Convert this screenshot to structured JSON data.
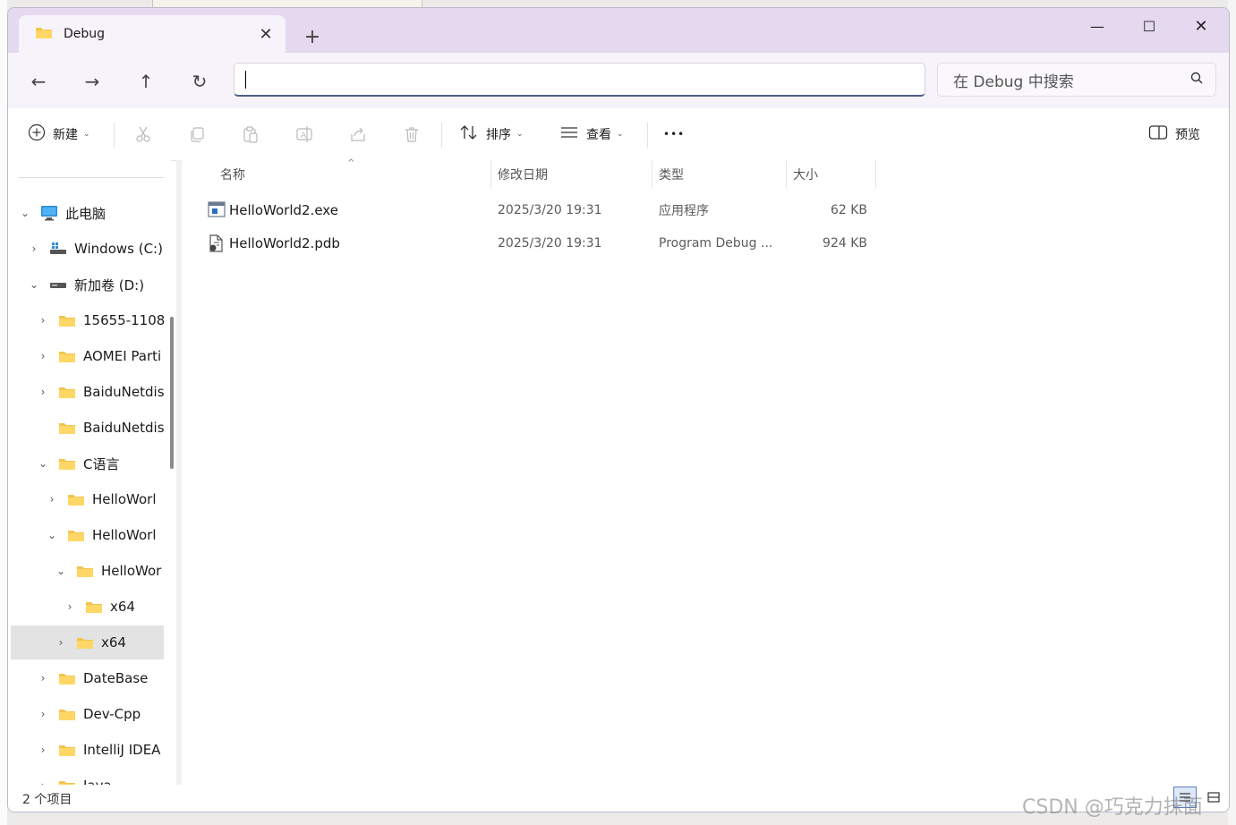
{
  "window": {
    "tab_title": "Debug",
    "new_tab_glyph": "+",
    "close_tab_glyph": "✕",
    "minimize_glyph": "—",
    "maximize_glyph": "☐",
    "close_glyph": "✕"
  },
  "nav": {
    "back_glyph": "←",
    "forward_glyph": "→",
    "up_glyph": "↑",
    "refresh_glyph": "↻",
    "address_value": "",
    "search_placeholder": "在 Debug 中搜索"
  },
  "toolbar": {
    "new_label": "新建",
    "sort_label": "排序",
    "view_label": "查看",
    "more_glyph": "•••",
    "preview_label": "预览",
    "icons": [
      "cut-icon",
      "copy-icon",
      "paste-icon",
      "rename-icon",
      "share-icon",
      "delete-icon"
    ]
  },
  "sidebar": {
    "items": [
      {
        "label": "此电脑",
        "chevron": "⌄",
        "icon": "this-pc-icon"
      },
      {
        "label": "Windows (C:)",
        "chevron": "›",
        "icon": "windows-drive-icon"
      },
      {
        "label": "新加卷 (D:)",
        "chevron": "⌄",
        "icon": "drive-icon"
      },
      {
        "label": "15655-1108",
        "chevron": "›",
        "icon": "folder-icon"
      },
      {
        "label": "AOMEI Parti",
        "chevron": "›",
        "icon": "folder-icon"
      },
      {
        "label": "BaiduNetdis",
        "chevron": "›",
        "icon": "folder-icon"
      },
      {
        "label": "BaiduNetdis",
        "chevron": "",
        "icon": "folder-icon"
      },
      {
        "label": "C语言",
        "chevron": "⌄",
        "icon": "folder-icon"
      },
      {
        "label": "HelloWorl",
        "chevron": "›",
        "icon": "folder-icon"
      },
      {
        "label": "HelloWorl",
        "chevron": "⌄",
        "icon": "folder-icon"
      },
      {
        "label": "HelloWor",
        "chevron": "⌄",
        "icon": "folder-icon"
      },
      {
        "label": "x64",
        "chevron": "›",
        "icon": "folder-icon"
      },
      {
        "label": "x64",
        "chevron": "›",
        "icon": "folder-icon"
      },
      {
        "label": "DateBase",
        "chevron": "›",
        "icon": "folder-icon"
      },
      {
        "label": "Dev-Cpp",
        "chevron": "›",
        "icon": "folder-icon"
      },
      {
        "label": "IntelliJ IDEA",
        "chevron": "›",
        "icon": "folder-icon"
      },
      {
        "label": "Java",
        "chevron": "›",
        "icon": "folder-icon"
      }
    ],
    "selected_index": 12
  },
  "columns": {
    "name": "名称",
    "date": "修改日期",
    "type": "类型",
    "size": "大小",
    "sort_glyph": "^"
  },
  "files": [
    {
      "name": "HelloWorld2.exe",
      "date": "2025/3/20 19:31",
      "type": "应用程序",
      "size": "62 KB",
      "icon": "exe-icon"
    },
    {
      "name": "HelloWorld2.pdb",
      "date": "2025/3/20 19:31",
      "type": "Program Debug ...",
      "size": "924 KB",
      "icon": "pdb-icon"
    }
  ],
  "status": {
    "item_count": "2 个项目"
  },
  "watermark": "CSDN @巧克力抹面"
}
